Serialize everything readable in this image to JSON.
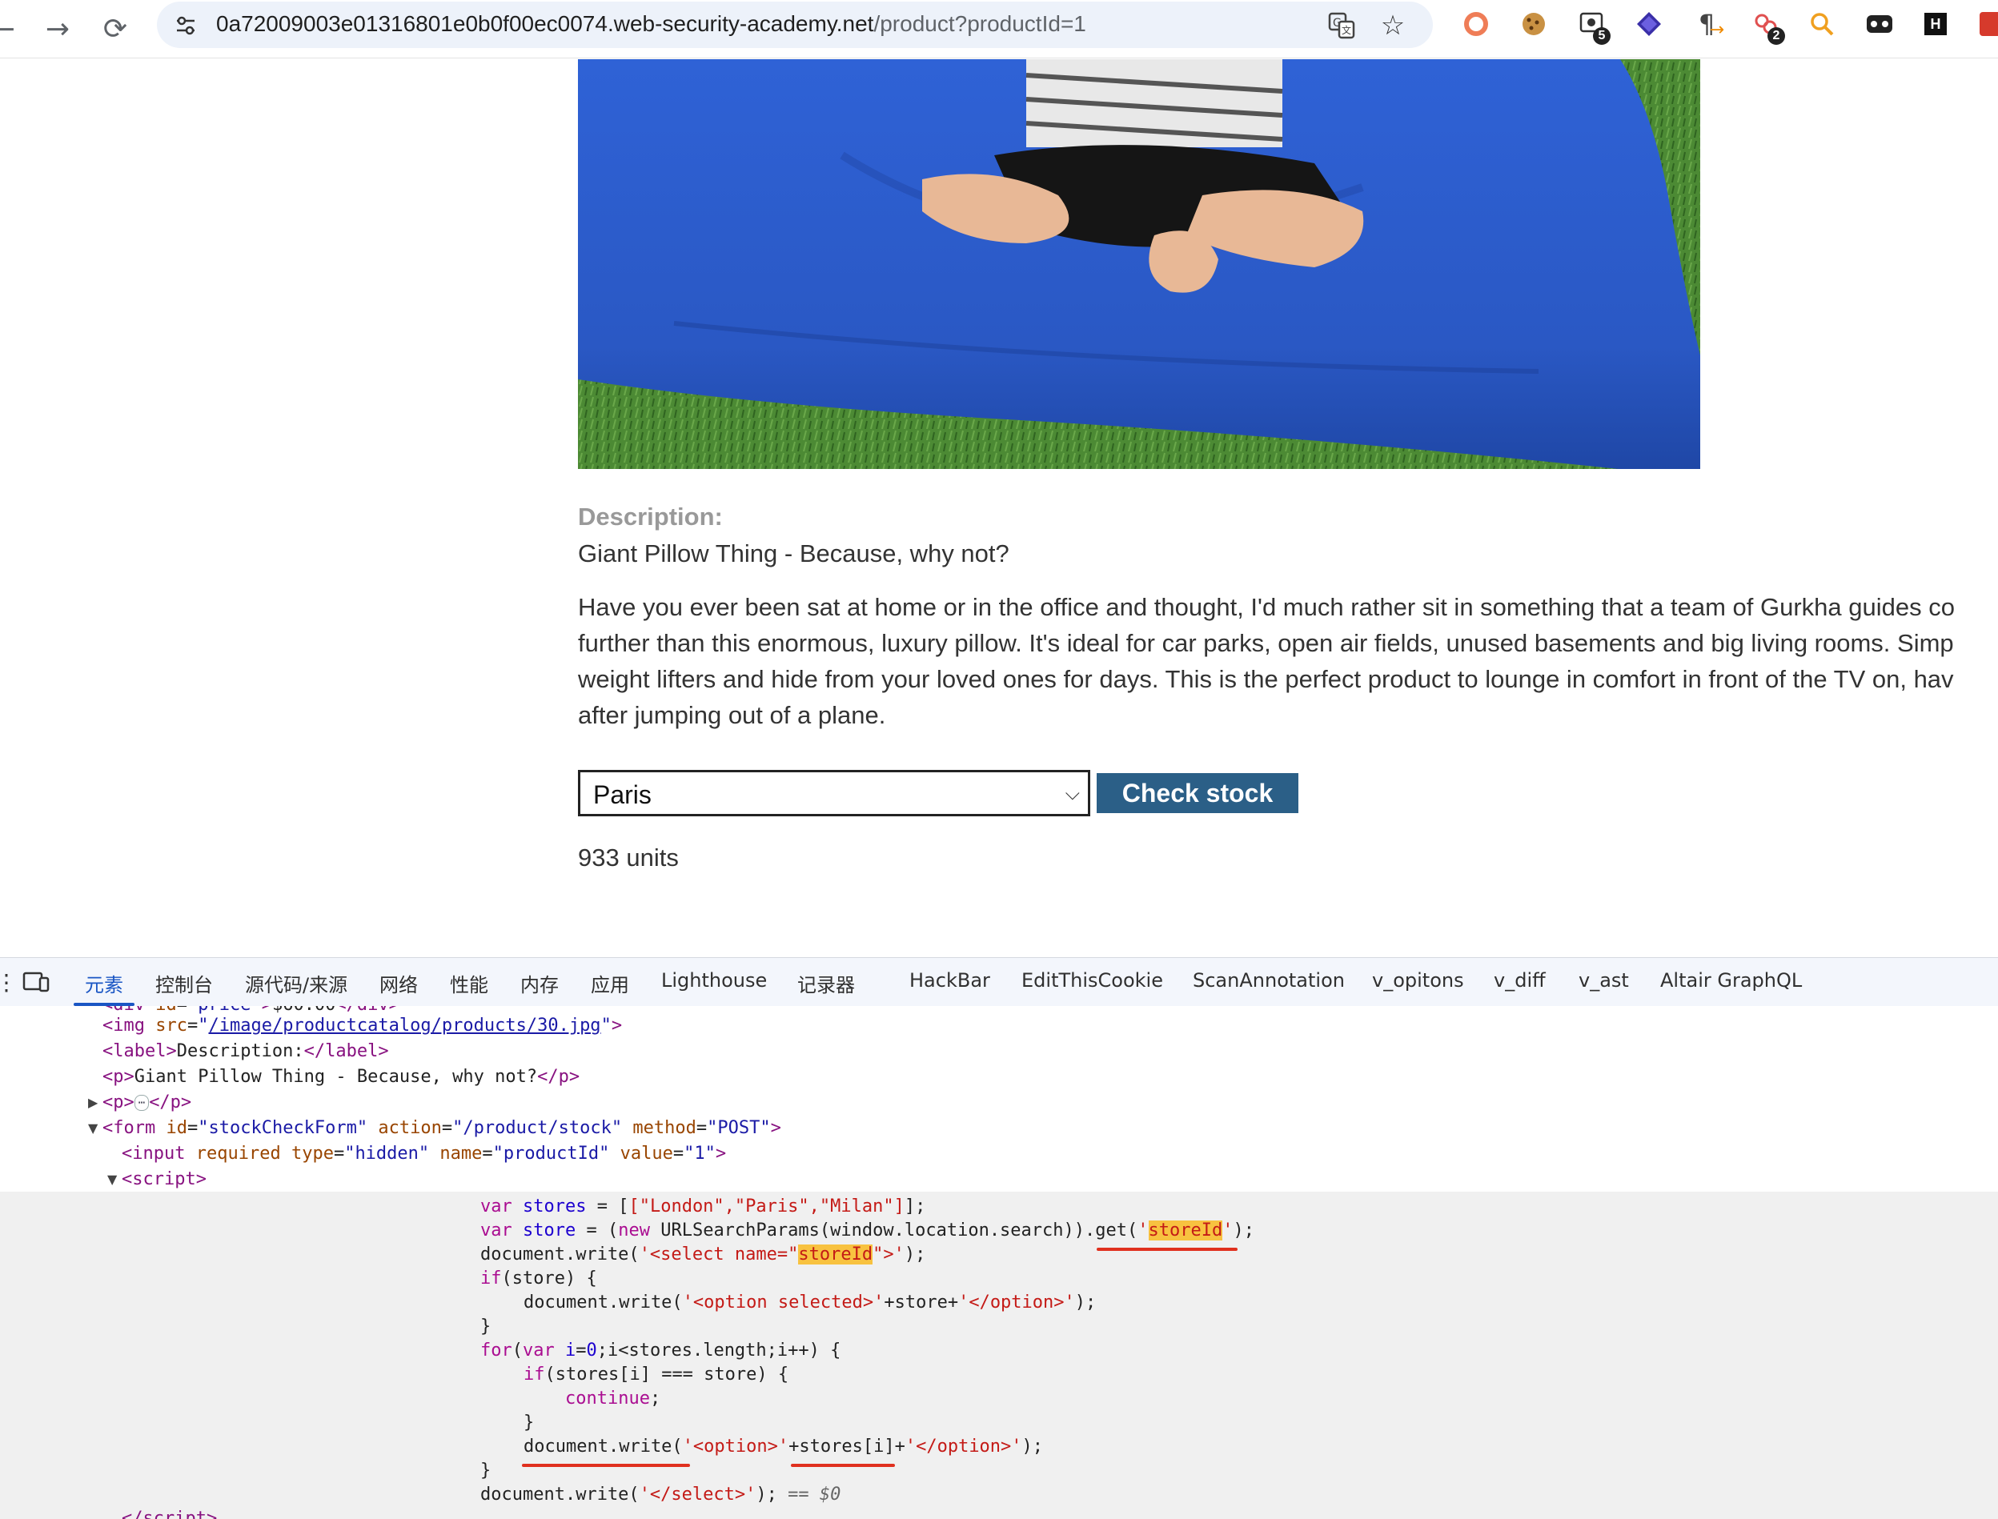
{
  "browser": {
    "url_host": "0a72009003e01316801e0b0f00ec0074.web-security-academy.net",
    "url_path": "/product?productId=1",
    "extension_badges": [
      "5",
      "2"
    ],
    "extension_letters": [
      "H"
    ]
  },
  "product": {
    "description_label": "Description:",
    "description_short": "Giant Pillow Thing - Because, why not?",
    "description_long": [
      "Have you ever been sat at home or in the office and thought, I'd much rather sit in something that a team of Gurkha guides co",
      "further than this enormous, luxury pillow. It's ideal for car parks, open air fields, unused basements and big living rooms. Simp",
      "weight lifters and hide from your loved ones for days. This is the perfect product to lounge in comfort in front of the TV on, hav",
      "after jumping out of a plane."
    ],
    "store_select_value": "Paris",
    "check_stock_label": "Check stock",
    "stock_result": "933 units"
  },
  "devtools": {
    "tabs": [
      "元素",
      "控制台",
      "源代码/来源",
      "网络",
      "性能",
      "内存",
      "应用",
      "Lighthouse",
      "记录器",
      "HackBar",
      "EditThisCookie",
      "ScanAnnotation",
      "v_opitons",
      "v_diff",
      "v_ast",
      "Altair GraphQL"
    ],
    "active_tab": "元素"
  },
  "code": {
    "img_src": "/image/productcatalog/products/30.jpg",
    "label_text": "Description:",
    "p_text": "Giant Pillow Thing - Because, why not?",
    "form_id": "stockCheckForm",
    "form_action": "/product/stock",
    "form_method": "POST",
    "input_type": "hidden",
    "input_name": "productId",
    "input_value": "1",
    "stores": "[\"London\",\"Paris\",\"Milan\"]",
    "param_name": "storeId",
    "selected_marker": "== $0"
  },
  "colors": {
    "check_button": "#2b5f87",
    "active_tab": "#1a56c4",
    "highlight": "#f8c240",
    "underline": "#e0301e",
    "pillow": "#2f62d6"
  },
  "icons": [
    "back-arrow-icon",
    "forward-arrow-icon",
    "reload-icon",
    "site-settings-icon",
    "translate-icon",
    "bookmark-star-icon",
    "search-extension-icon",
    "device-toolbar-icon",
    "chevron-down-icon"
  ]
}
